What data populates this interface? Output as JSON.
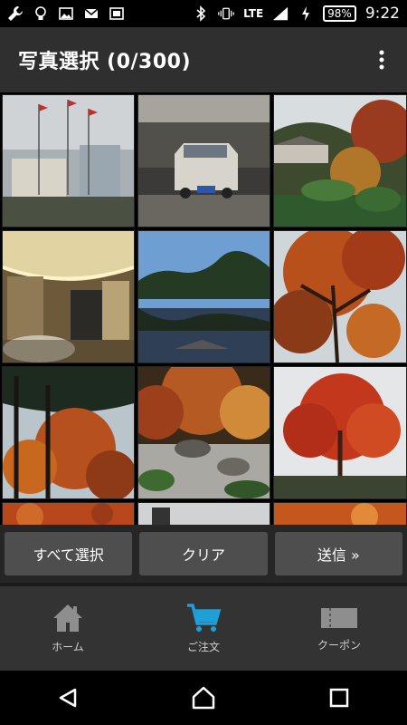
{
  "status_bar": {
    "network": "LTE",
    "battery": "98%",
    "time": "9:22",
    "icons": [
      "wrench-icon",
      "lightbulb-icon",
      "image-icon",
      "mail-icon",
      "notification-icon",
      "bluetooth-icon",
      "vibrate-icon",
      "signal-icon",
      "charging-icon",
      "battery-icon"
    ]
  },
  "header": {
    "title": "写真選択 (0/300)",
    "menu_icon": "overflow-menu-icon"
  },
  "photos": [
    {
      "name": "photo-plaza-flags"
    },
    {
      "name": "photo-taxi"
    },
    {
      "name": "photo-garden-pavilion"
    },
    {
      "name": "photo-hotel-lobby"
    },
    {
      "name": "photo-lake-reflection"
    },
    {
      "name": "photo-autumn-tree-1"
    },
    {
      "name": "photo-autumn-tree-2"
    },
    {
      "name": "photo-rock-garden"
    },
    {
      "name": "photo-red-maple"
    },
    {
      "name": "photo-partial-1"
    },
    {
      "name": "photo-partial-2"
    },
    {
      "name": "photo-partial-3"
    }
  ],
  "actions": {
    "select_all": "すべて選択",
    "clear": "クリア",
    "send": "送信 »"
  },
  "tabs": {
    "home": "ホーム",
    "order": "ご注文",
    "coupon": "クーポン"
  },
  "colors": {
    "accent": "#1e9fd8",
    "app_bar": "#2f2f2f",
    "button": "#4e4e4e"
  }
}
